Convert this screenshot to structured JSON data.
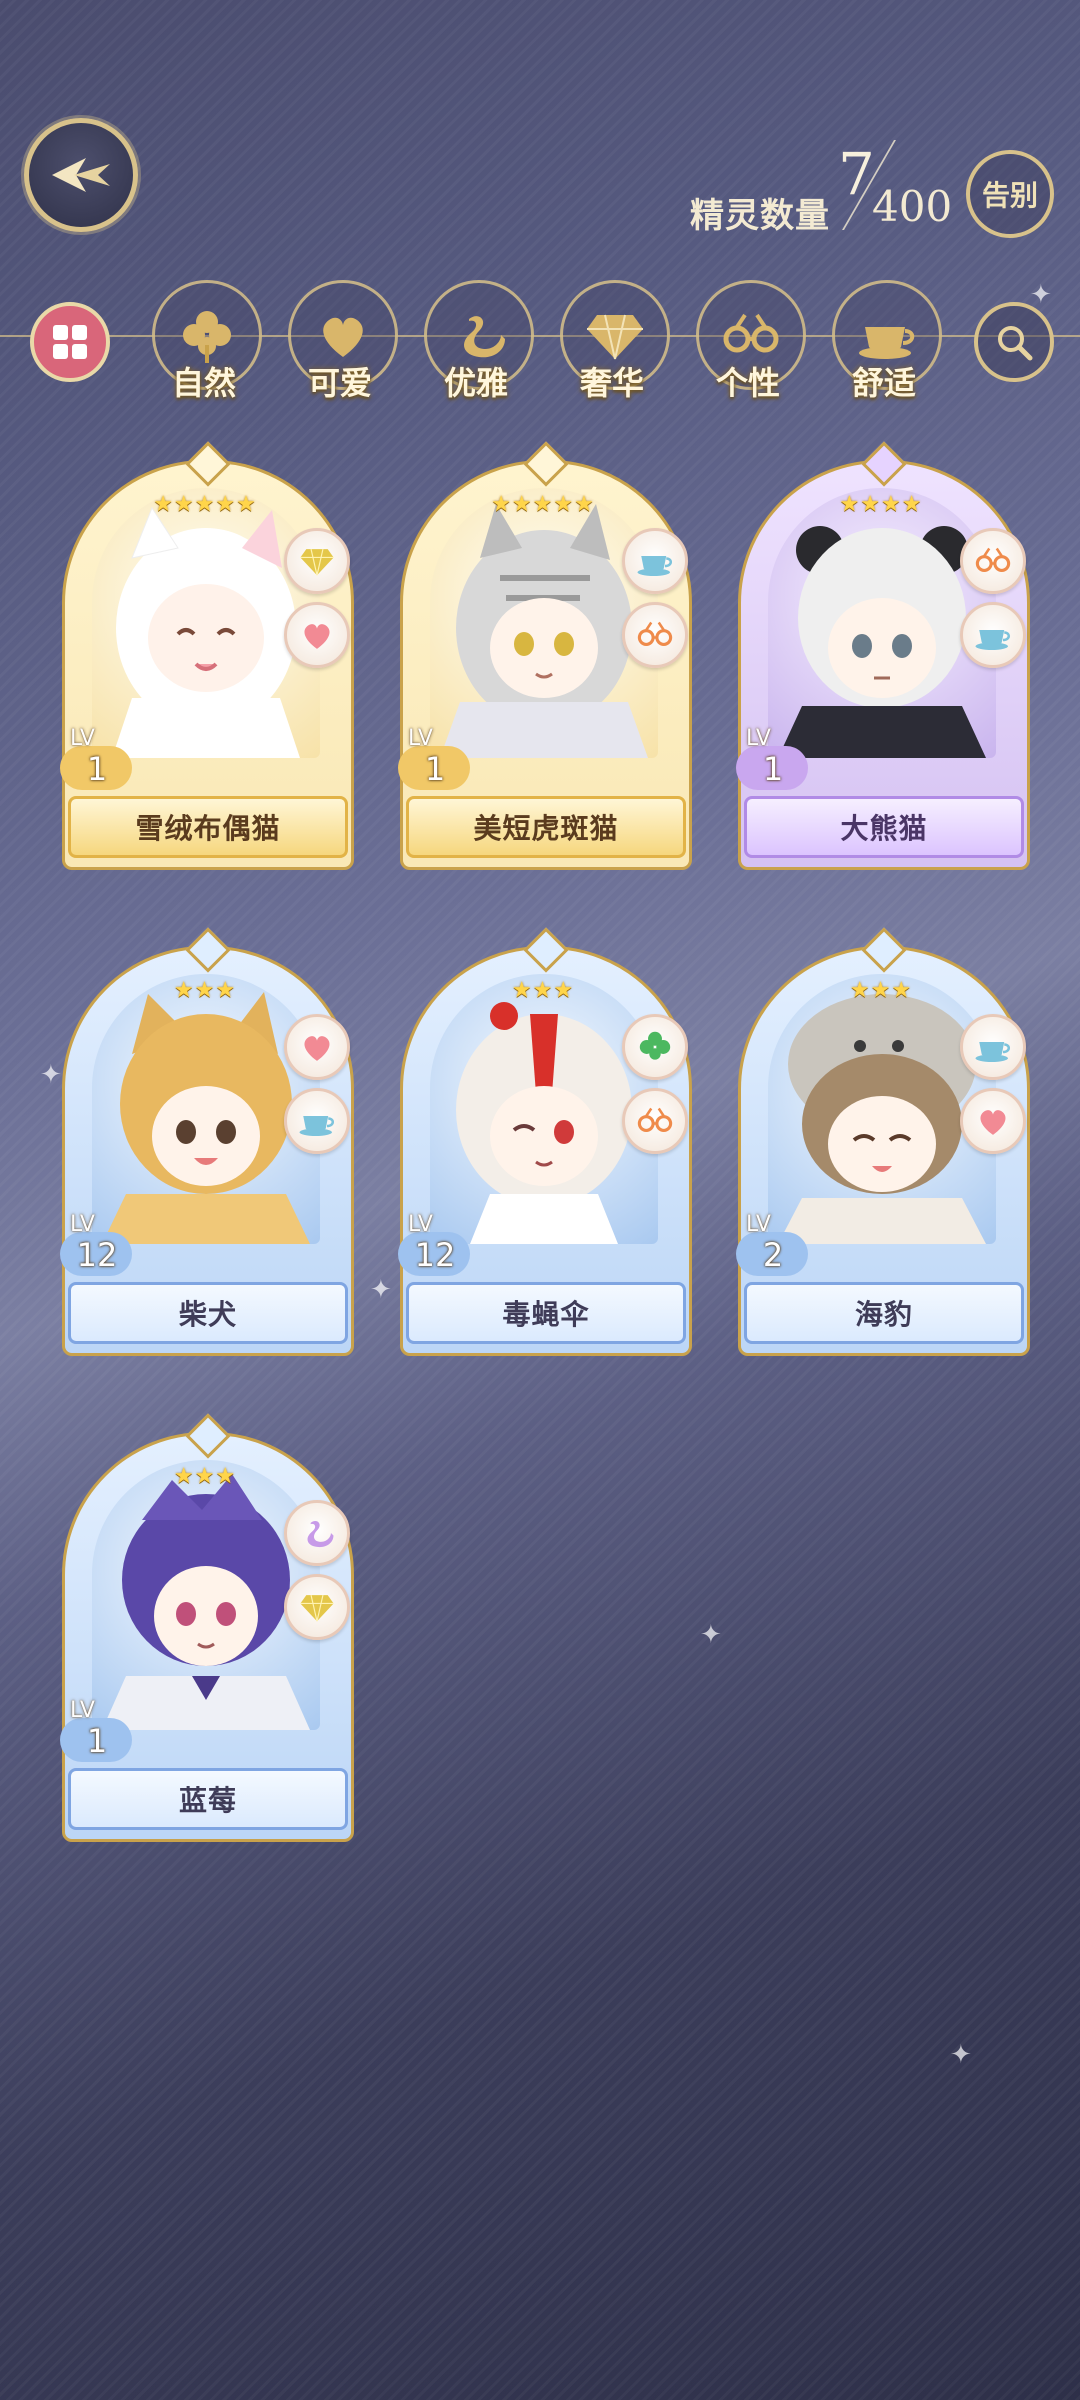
{
  "header": {
    "count_label": "精灵数量",
    "count_current": "7",
    "count_total": "400",
    "farewell_label": "告别"
  },
  "categories": [
    {
      "label": "自然",
      "icon": "clover-icon"
    },
    {
      "label": "可爱",
      "icon": "heart-icon"
    },
    {
      "label": "优雅",
      "icon": "swan-icon"
    },
    {
      "label": "奢华",
      "icon": "diamond-icon"
    },
    {
      "label": "个性",
      "icon": "glasses-icon"
    },
    {
      "label": "舒适",
      "icon": "teacup-icon"
    }
  ],
  "cards": [
    {
      "name": "雪绒布偶猫",
      "lv_label": "LV",
      "level": "1",
      "stars": "★★★★★",
      "theme": "gold",
      "traits": [
        "diamond-icon",
        "heart-icon"
      ]
    },
    {
      "name": "美短虎斑猫",
      "lv_label": "LV",
      "level": "1",
      "stars": "★★★★★",
      "theme": "gold",
      "traits": [
        "teacup-icon",
        "glasses-icon"
      ]
    },
    {
      "name": "大熊猫",
      "lv_label": "LV",
      "level": "1",
      "stars": "★★★★",
      "theme": "purple",
      "traits": [
        "glasses-icon",
        "teacup-icon"
      ]
    },
    {
      "name": "柴犬",
      "lv_label": "LV",
      "level": "12",
      "stars": "★★★",
      "theme": "blue",
      "traits": [
        "heart-icon",
        "teacup-icon"
      ]
    },
    {
      "name": "毒蝇伞",
      "lv_label": "LV",
      "level": "12",
      "stars": "★★★",
      "theme": "blue",
      "traits": [
        "clover-icon",
        "glasses-icon"
      ]
    },
    {
      "name": "海豹",
      "lv_label": "LV",
      "level": "2",
      "stars": "★★★",
      "theme": "blue",
      "traits": [
        "teacup-icon",
        "heart-icon"
      ]
    },
    {
      "name": "蓝莓",
      "lv_label": "LV",
      "level": "1",
      "stars": "★★★",
      "theme": "blue",
      "traits": [
        "swan-icon",
        "diamond-icon"
      ]
    }
  ],
  "colors": {
    "gold_accent": "#d8c28b",
    "all_button": "#d9667a"
  }
}
